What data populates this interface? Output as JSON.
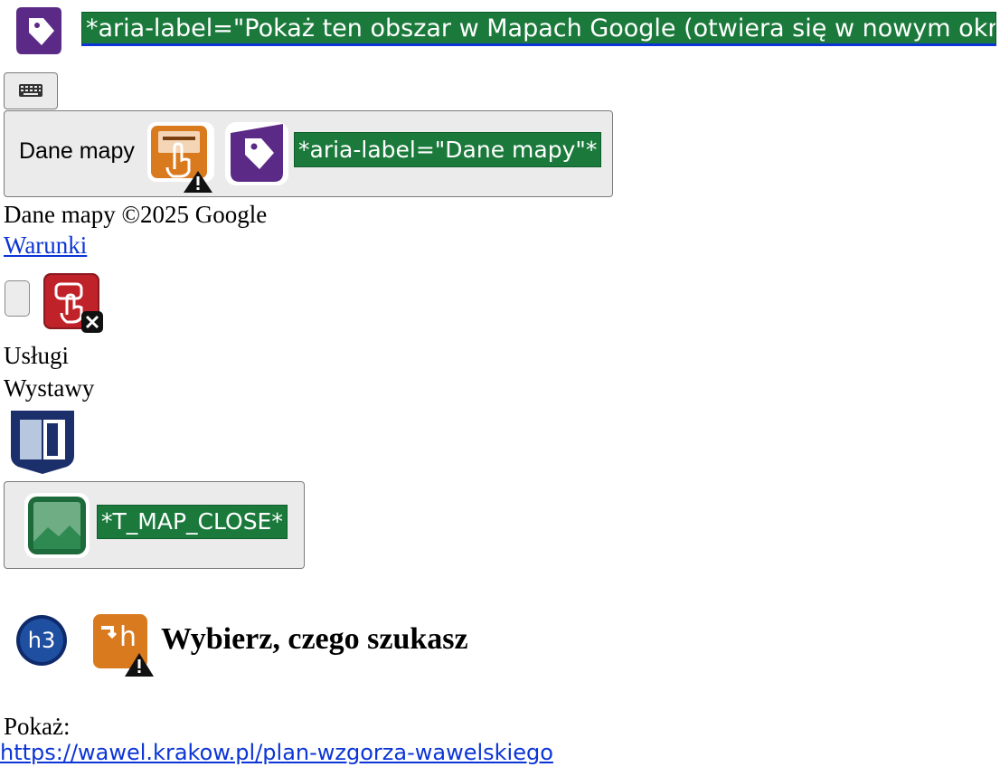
{
  "top_annotation": {
    "aria_label_text": "*aria-label=\"Pokaż ten obszar w Mapach Google (otwiera się w nowym oknie)\"*",
    "icon": "aria-label-tag-icon"
  },
  "keyboard_button": {
    "icon": "keyboard-icon"
  },
  "map_data_button": {
    "label": "Dane mapy",
    "aria_label_text": "*aria-label=\"Dane mapy\"*",
    "icons": [
      "device-dependent-event-handler-alert-icon",
      "aria-label-tag-icon"
    ]
  },
  "map_attribution": {
    "text": "Dane mapy ©2025 Google",
    "terms_link": "Warunki"
  },
  "checkbox_row": {
    "icon": "missing-form-label-error-icon"
  },
  "filters": {
    "items": [
      "Usługi",
      "Wystawy"
    ]
  },
  "tablist_icon": "aria-tablist-icon",
  "close_map_button": {
    "aria_label_text": "*T_MAP_CLOSE*",
    "icon": "image-alt-icon"
  },
  "section_heading": {
    "h3_badge": "h3",
    "icons": [
      "heading-level-h3-icon",
      "possible-heading-alert-icon"
    ],
    "title": "Wybierz, czego szukasz"
  },
  "show_label": "Pokaż:",
  "status_bar": {
    "url": "https://wawel.krakow.pl/plan-wzgorza-wawelskiego"
  },
  "colors": {
    "aria_green": "#1b7a3b",
    "purple_tag": "#5b2a86",
    "orange_alert": "#d97a1f",
    "red_error": "#c0222a",
    "navy_structure": "#1b2f6b",
    "link_blue": "#0b35d6"
  }
}
